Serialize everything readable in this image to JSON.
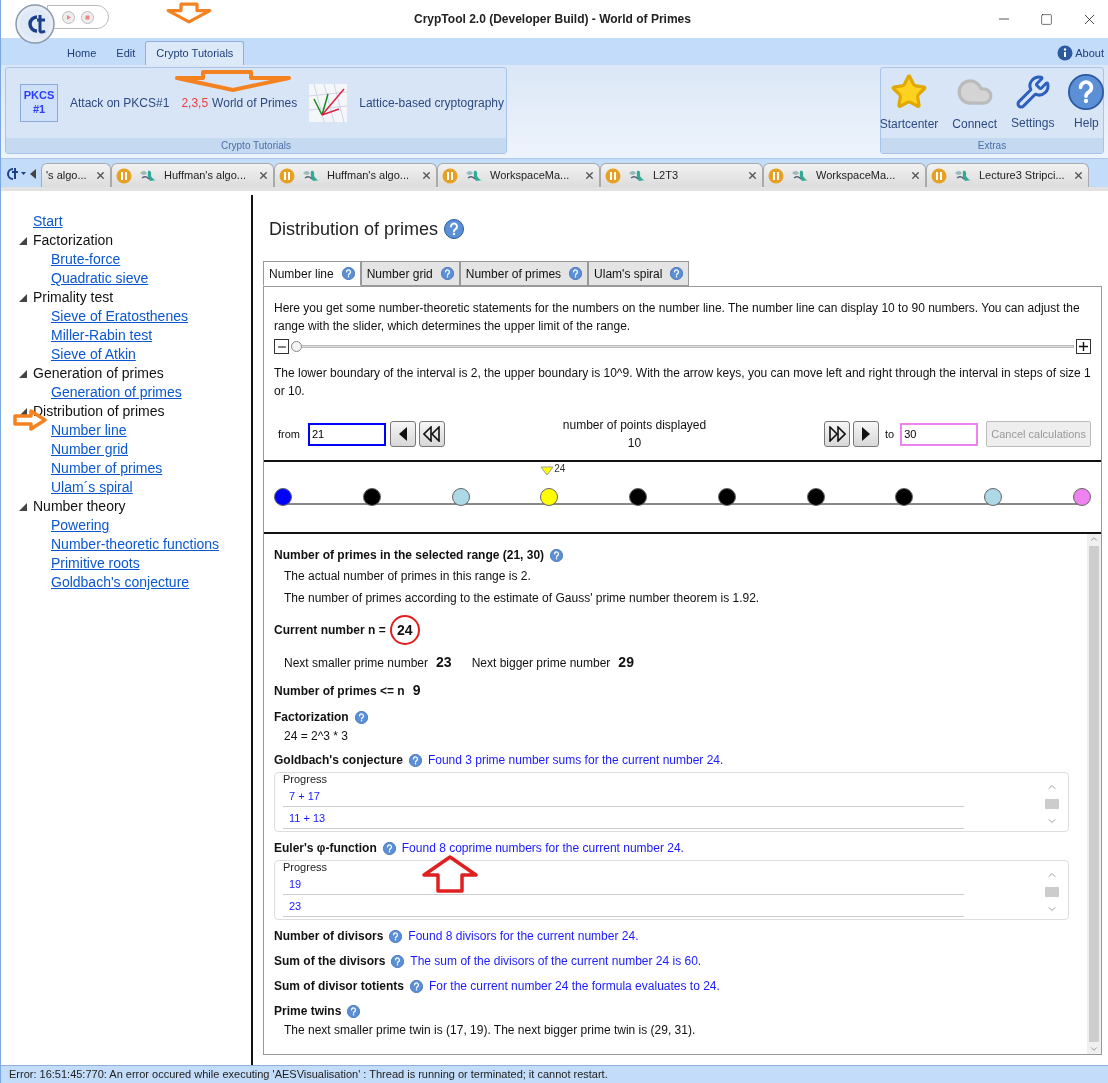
{
  "window": {
    "title": "CrypTool 2.0 (Developer Build) - World of Primes"
  },
  "ribbon_tabs": [
    {
      "label": "Home",
      "selected": false
    },
    {
      "label": "Edit",
      "selected": false
    },
    {
      "label": "Crypto Tutorials",
      "selected": true
    }
  ],
  "about": "About",
  "ribbon_groups": [
    {
      "title": "Crypto Tutorials",
      "items": [
        {
          "kind": "pkcs",
          "badge": "PKCS\n#1",
          "label": "Attack on PKCS#1"
        },
        {
          "kind": "primes",
          "badge": "2,3,5",
          "label": "World of Primes"
        },
        {
          "kind": "lattice",
          "label": "Lattice-based cryptography"
        }
      ]
    },
    {
      "title": "Extras",
      "items": [
        {
          "kind": "star",
          "label": "Startcenter"
        },
        {
          "kind": "cloud",
          "label": "Connect"
        },
        {
          "kind": "tools",
          "label": "Settings"
        },
        {
          "kind": "help",
          "label": "Help"
        }
      ]
    }
  ],
  "doc_tabs": [
    {
      "label": "'s algo...",
      "paused": false
    },
    {
      "label": "Huffman's algo...",
      "paused": true
    },
    {
      "label": "Huffman's algo...",
      "paused": true
    },
    {
      "label": "WorkspaceMa...",
      "paused": true
    },
    {
      "label": "L2T3",
      "paused": true
    },
    {
      "label": "WorkspaceMa...",
      "paused": true
    },
    {
      "label": "Lecture3 Stripci...",
      "paused": true
    }
  ],
  "sidebar": [
    {
      "kind": "link",
      "label": "Start"
    },
    {
      "kind": "group",
      "label": "Factorization",
      "expanded": true,
      "children": [
        {
          "kind": "link",
          "label": "Brute-force"
        },
        {
          "kind": "link",
          "label": "Quadratic sieve"
        }
      ]
    },
    {
      "kind": "group",
      "label": "Primality test",
      "expanded": true,
      "children": [
        {
          "kind": "link",
          "label": "Sieve of Eratosthenes"
        },
        {
          "kind": "link",
          "label": "Miller-Rabin test"
        },
        {
          "kind": "link",
          "label": "Sieve of Atkin"
        }
      ]
    },
    {
      "kind": "group",
      "label": "Generation of primes",
      "expanded": true,
      "children": [
        {
          "kind": "link",
          "label": "Generation of primes"
        }
      ]
    },
    {
      "kind": "group",
      "label": "Distribution of primes",
      "expanded": true,
      "children": [
        {
          "kind": "link",
          "label": "Number line"
        },
        {
          "kind": "link",
          "label": "Number grid"
        },
        {
          "kind": "link",
          "label": "Number of primes"
        },
        {
          "kind": "link",
          "label": "Ulam´s spiral"
        }
      ]
    },
    {
      "kind": "group",
      "label": "Number theory",
      "expanded": true,
      "children": [
        {
          "kind": "link",
          "label": "Powering"
        },
        {
          "kind": "link",
          "label": "Number-theoretic functions"
        },
        {
          "kind": "link",
          "label": "Primitive roots"
        },
        {
          "kind": "link",
          "label": "Goldbach's conjecture"
        }
      ]
    }
  ],
  "page_title": "Distribution of primes",
  "content_tabs": [
    {
      "label": "Number line",
      "selected": true
    },
    {
      "label": "Number grid",
      "selected": false
    },
    {
      "label": "Number of primes",
      "selected": false
    },
    {
      "label": "Ulam's spiral",
      "selected": false
    }
  ],
  "intro": "Here you get some number-theoretic statements for the numbers on the number line. The number line can display 10 to 90 numbers. You can adjust the range with the slider, which determines the upper limit of the range.",
  "slider": {
    "level": 0
  },
  "interval_text": "The lower boundary of the interval is 2, the upper boundary is 10^9. With the arrow keys, you can move left and right through the interval in steps of size 1 or 10.",
  "from": {
    "label": "from",
    "value": "21"
  },
  "points_label": "number of points displayed",
  "points_value": "10",
  "to": {
    "label": "to",
    "value": "30"
  },
  "cancel_button": {
    "label": "Cancel calculations",
    "disabled": true
  },
  "number_line": [
    {
      "color": "#0000ff"
    },
    {
      "color": "#000000"
    },
    {
      "color": "#add8e6"
    },
    {
      "color": "#ffff00",
      "marker": "24"
    },
    {
      "color": "#000000"
    },
    {
      "color": "#000000"
    },
    {
      "color": "#000000"
    },
    {
      "color": "#000000"
    },
    {
      "color": "#add8e6"
    },
    {
      "color": "#ee82ee"
    }
  ],
  "results": [
    {
      "kind": "section",
      "title": "Number of primes in the selected range (21, 30)",
      "help": true,
      "lines": [
        "The actual number of primes in this range is 2.",
        "The number of primes according to the estimate of Gauss' prime number theorem is 1.92."
      ]
    },
    {
      "kind": "value",
      "title": "Current number n =",
      "value": "24",
      "circled": true
    },
    {
      "kind": "pairs",
      "pairs": [
        {
          "label": "Next smaller prime number",
          "value": "23"
        },
        {
          "label": "Next bigger prime number",
          "value": "29"
        }
      ]
    },
    {
      "kind": "value",
      "title": "Number of primes <= n",
      "value": "9",
      "circled": false
    },
    {
      "kind": "section",
      "title": "Factorization",
      "help": true,
      "lines": [
        "24 = 2^3 * 3"
      ]
    },
    {
      "kind": "section",
      "title": "Goldbach's conjecture",
      "help": true,
      "summary": "Found 3 prime number sums for the current number 24.",
      "progress": {
        "label": "Progress",
        "items": [
          "7 + 17",
          "11 + 13"
        ]
      }
    },
    {
      "kind": "section",
      "title": "Euler's φ-function",
      "help": true,
      "summary": "Found 8 coprime numbers for the current number 24.",
      "pointer": true,
      "progress": {
        "label": "Progress",
        "items": [
          "19",
          "23"
        ]
      }
    },
    {
      "kind": "section",
      "title": "Number of divisors",
      "help": true,
      "summary": "Found 8 divisors for the current number 24."
    },
    {
      "kind": "section",
      "title": "Sum of the divisors",
      "help": true,
      "summary": "The sum of the divisors of the current number 24 is 60."
    },
    {
      "kind": "section",
      "title": "Sum of divisor totients",
      "help": true,
      "summary": "For the current number 24 the formula evaluates to 24."
    },
    {
      "kind": "section",
      "title": "Prime twins",
      "help": true,
      "lines": [
        "The next smaller prime twin is (17, 19). The next bigger prime twin is (29, 31)."
      ]
    }
  ],
  "status_bar": "Error: 16:51:45:770: An error occured while executing 'AESVisualisation' : Thread is running or terminated; it cannot restart."
}
